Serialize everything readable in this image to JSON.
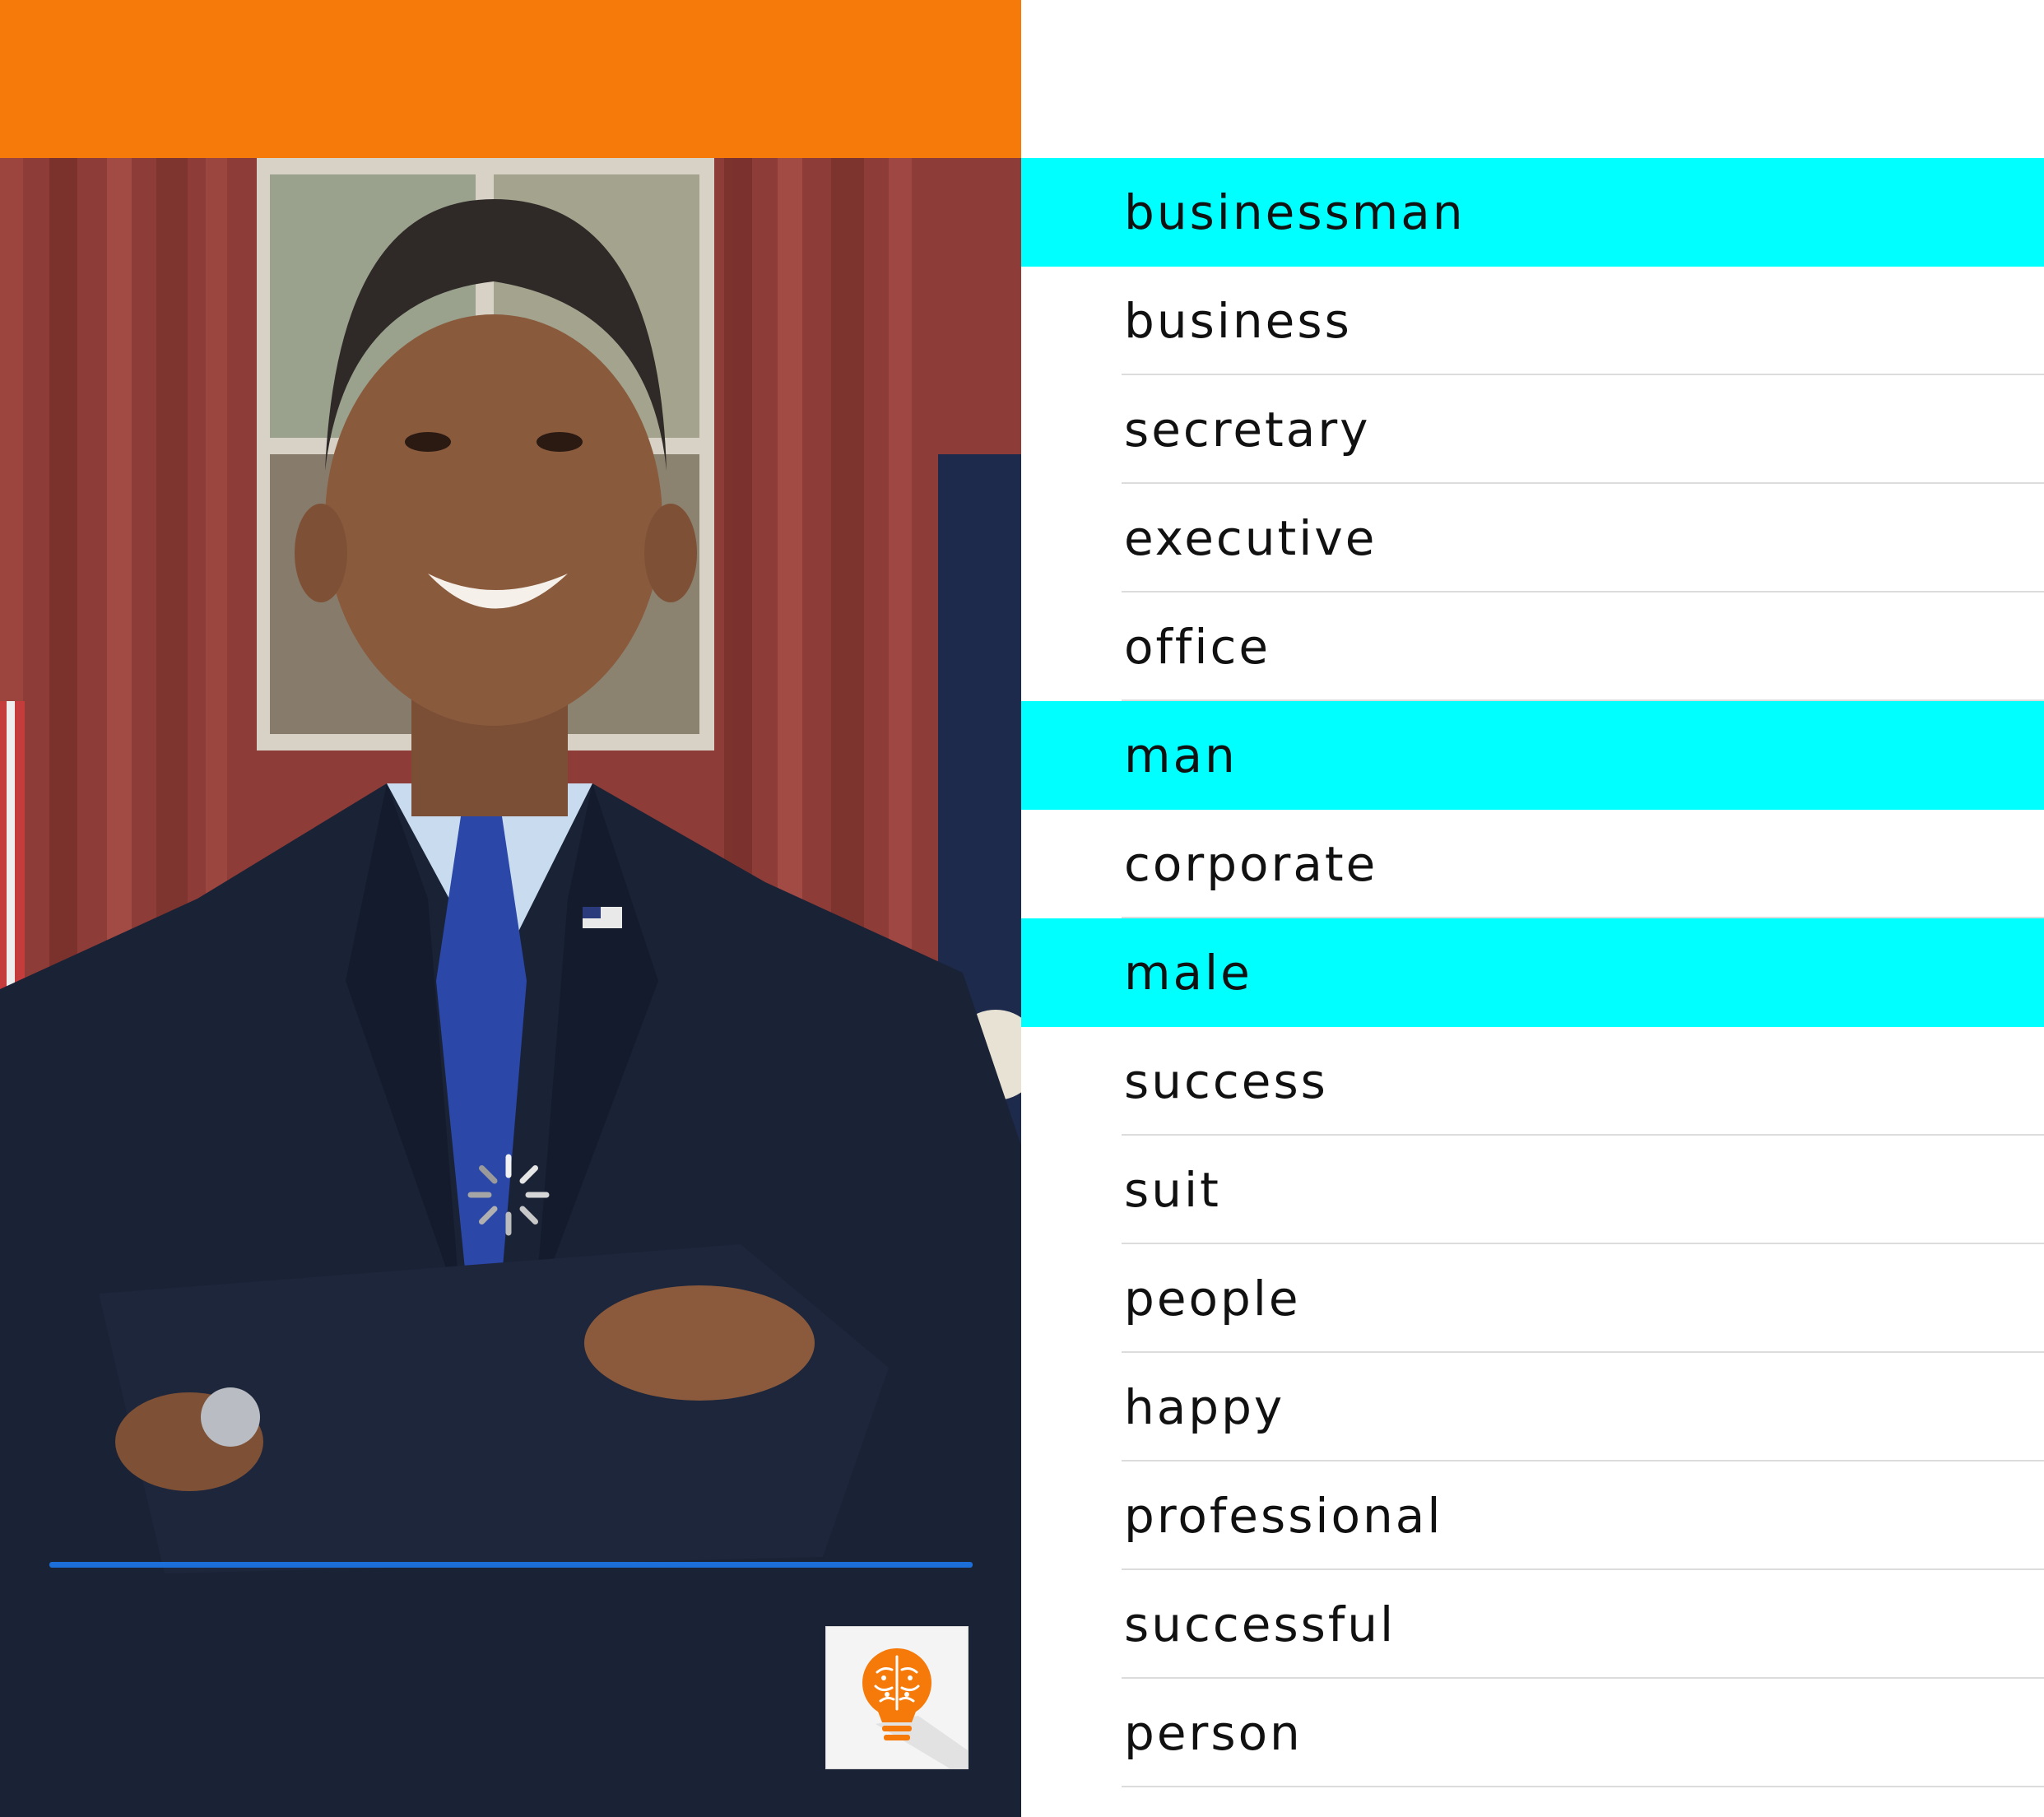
{
  "theme": {
    "accent": "#F57A0A",
    "highlight": "#00FFFF",
    "progress": "#1C6FD8",
    "divider": "#DCDCDC"
  },
  "photo": {
    "subject": "portrait photo of a man in a dark suit with arms crossed in an office"
  },
  "spinner": {
    "icon": "loading-spinner-icon"
  },
  "brain_button": {
    "icon": "lightbulb-brain-icon"
  },
  "tags": [
    {
      "label": "businessman",
      "highlighted": true
    },
    {
      "label": "business",
      "highlighted": false
    },
    {
      "label": "secretary",
      "highlighted": false
    },
    {
      "label": "executive",
      "highlighted": false
    },
    {
      "label": "office",
      "highlighted": false
    },
    {
      "label": "man",
      "highlighted": true
    },
    {
      "label": "corporate",
      "highlighted": false
    },
    {
      "label": "male",
      "highlighted": true
    },
    {
      "label": "success",
      "highlighted": false
    },
    {
      "label": "suit",
      "highlighted": false
    },
    {
      "label": "people",
      "highlighted": false
    },
    {
      "label": "happy",
      "highlighted": false
    },
    {
      "label": "professional",
      "highlighted": false
    },
    {
      "label": "successful",
      "highlighted": false
    },
    {
      "label": "person",
      "highlighted": false
    }
  ]
}
